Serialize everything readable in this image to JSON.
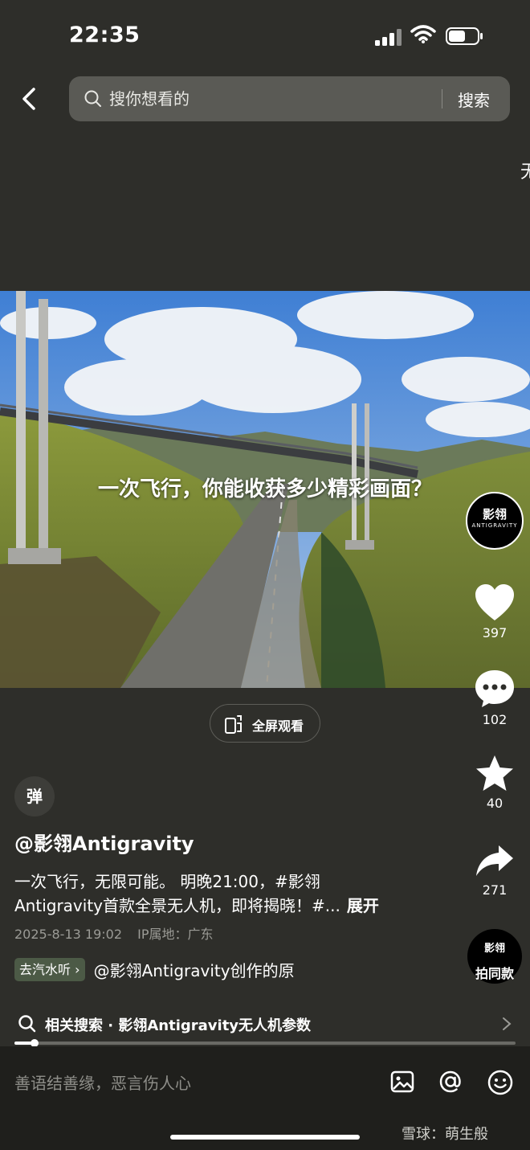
{
  "status_bar": {
    "time": "22:35"
  },
  "search": {
    "placeholder": "搜你想看的",
    "button_label": "搜索"
  },
  "edge_glyph": "无",
  "video": {
    "caption": "一次飞行，你能收获多少精彩画面？"
  },
  "fullscreen_label": "全屏观看",
  "side_actions": {
    "avatar_cn": "影翎",
    "avatar_en": "ANTIGRAVITY",
    "likes": "397",
    "comments": "102",
    "favorites": "40",
    "shares": "271",
    "capture_logo": "影翎",
    "capture_label": "拍同款"
  },
  "post": {
    "danmu_label": "弹",
    "author": "@影翎Antigravity",
    "line1": "一次飞行，无限可能。 明晚21:00，#影翎",
    "line2": "Antigravity首款全景无人机，即将揭晓！#...",
    "expand_label": "展开",
    "date": "2025-8-13 19:02",
    "ip_location": "IP属地：广东",
    "music_tag": "去汽水听 ›",
    "music_text": "@影翎Antigravity创作的原"
  },
  "related_search": {
    "text": "相关搜索 · 影翎Antigravity无人机参数"
  },
  "progress": {
    "played_fraction": 0.04
  },
  "bottom_bar": {
    "comment_placeholder": "善语结善缘，恶言伤人心"
  },
  "watermark": "雪球：萌生般",
  "colors": {
    "background": "#2e2e2a",
    "bottom_bar": "#1f1f1c",
    "music_tag": "#4c5a46"
  }
}
